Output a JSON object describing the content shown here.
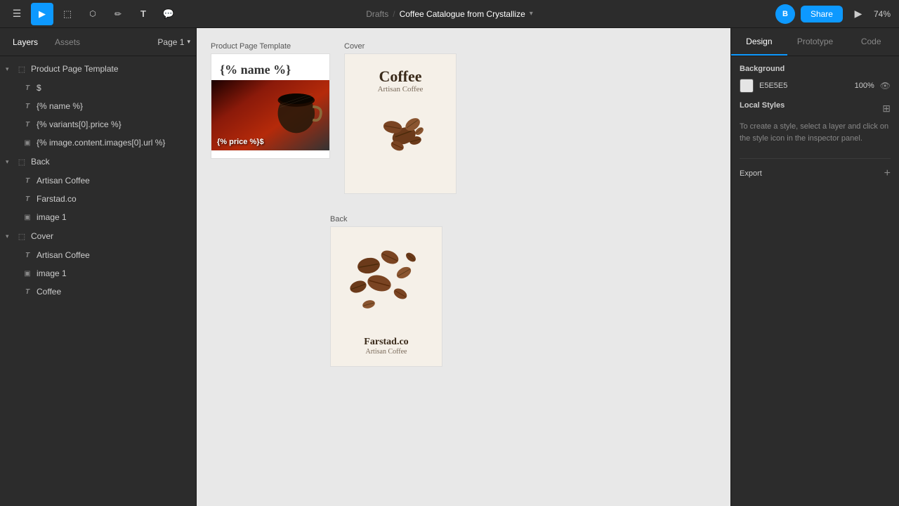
{
  "toolbar": {
    "title": "Coffee Catalogue from Crystallize",
    "breadcrumb_drafts": "Drafts",
    "breadcrumb_separator": "/",
    "zoom": "74%",
    "share_label": "Share",
    "avatar_label": "B",
    "tools": [
      {
        "name": "menu",
        "icon": "☰"
      },
      {
        "name": "select",
        "icon": "▲"
      },
      {
        "name": "frame",
        "icon": "⬜"
      },
      {
        "name": "shapes",
        "icon": "◇"
      },
      {
        "name": "text",
        "icon": "T"
      },
      {
        "name": "comment",
        "icon": "💬"
      }
    ]
  },
  "left_panel": {
    "tabs": [
      {
        "label": "Layers",
        "active": true
      },
      {
        "label": "Assets",
        "active": false
      }
    ],
    "page_selector": "Page 1",
    "layers": {
      "product_page_template": {
        "label": "Product Page Template",
        "children": [
          {
            "type": "text",
            "label": "$"
          },
          {
            "type": "text",
            "label": "{% name %}"
          },
          {
            "type": "text",
            "label": "{% variants[0].price %}"
          },
          {
            "type": "image",
            "label": "{% image.content.images[0].url %}"
          }
        ]
      },
      "back": {
        "label": "Back",
        "children": [
          {
            "type": "text",
            "label": "Artisan Coffee"
          },
          {
            "type": "text",
            "label": "Farstad.co"
          },
          {
            "type": "image",
            "label": "image 1"
          }
        ]
      },
      "cover": {
        "label": "Cover",
        "children": [
          {
            "type": "text",
            "label": "Artisan Coffee"
          },
          {
            "type": "image",
            "label": "image 1"
          },
          {
            "type": "text",
            "label": "Coffee"
          }
        ]
      }
    }
  },
  "canvas": {
    "frames": [
      {
        "label": "Product Page Template",
        "type": "template"
      },
      {
        "label": "Cover",
        "type": "cover",
        "title": "Coffee",
        "subtitle": "Artisan Coffee"
      },
      {
        "label": "Back",
        "type": "back",
        "company": "Farstad.co",
        "company_sub": "Artisan Coffee"
      }
    ]
  },
  "right_panel": {
    "tabs": [
      {
        "label": "Design",
        "active": true
      },
      {
        "label": "Prototype",
        "active": false
      },
      {
        "label": "Code",
        "active": false
      }
    ],
    "background": {
      "section_title": "Background",
      "color": "E5E5E5",
      "opacity": "100%"
    },
    "local_styles": {
      "section_title": "Local Styles",
      "hint": "To create a style, select a layer and click on the style icon in the inspector panel."
    },
    "export": {
      "label": "Export",
      "add_icon": "+"
    }
  }
}
